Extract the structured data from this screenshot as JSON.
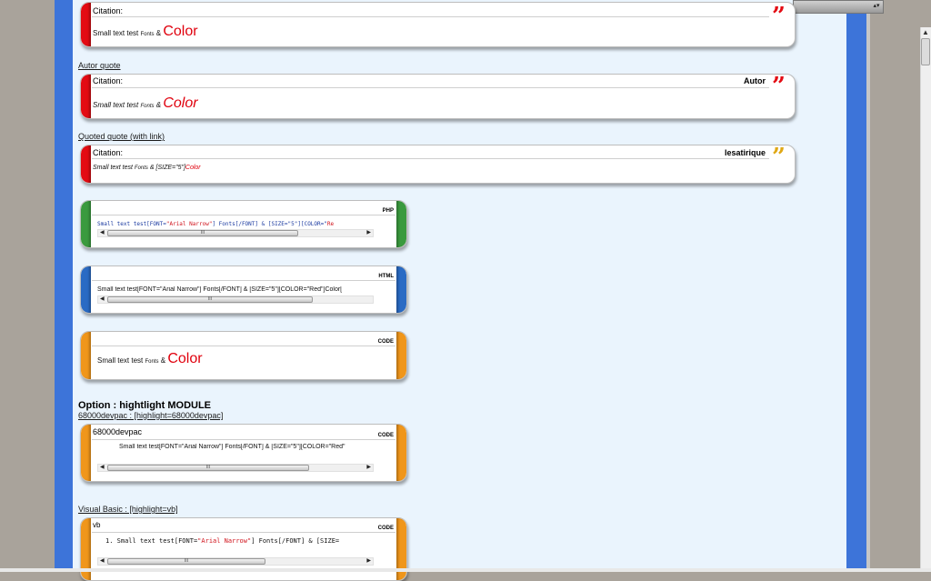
{
  "colors": {
    "quote_bar": "#e30b13",
    "php_bar": "#3a9a3e",
    "html_bar": "#2a6bc4",
    "code_bar": "#f0961b",
    "page_blue": "#3d74d9"
  },
  "quote1": {
    "title": "Citation:",
    "text_a": "Small text test",
    "text_b": "Fonts",
    "text_c": "&",
    "color_word": "Color"
  },
  "autor_link": "Autor quote",
  "quote2": {
    "title": "Citation:",
    "author": "Autor",
    "text_a": "Small text test",
    "text_b": "Fonts",
    "text_c": "&",
    "color_word": "Color"
  },
  "quoted_link": "Quoted quote (with link)",
  "quote3": {
    "title": "Citation:",
    "author": "lesatirique",
    "text_a": "Small text test",
    "text_b": "Fonts",
    "text_c": "& [SIZE=\"5\"]",
    "color_word": "Color"
  },
  "php_box": {
    "tag": "PHP",
    "code_a": "Small text test[FONT=",
    "code_b": "\"Arial Narrow\"",
    "code_c": "] Fonts[/FONT] & [SIZE=\"5\"][COLOR=\"",
    "code_d": "Re"
  },
  "html_box": {
    "tag": "HTML",
    "code": "Small text test[FONT=\"Arial Narrow\"] Fonts[/FONT] & [SIZE=\"5\"][COLOR=\"Red\"]Color["
  },
  "code_box": {
    "tag": "CODE",
    "text_a": "Small text test",
    "text_b": "Fonts",
    "text_c": "&",
    "color_word": "Color"
  },
  "option_heading": "Option : hightlight MODULE",
  "devpac_link": "68000devpac : [highlight=68000devpac]",
  "devpac_box": {
    "tag": "CODE",
    "name": "68000devpac",
    "code": "Small text test[FONT=\"Arial Narrow\"] Fonts[/FONT] & [SIZE=\"5\"][COLOR=\"Red\""
  },
  "vb_link": "Visual Basic : [highlight=vb]",
  "vb_box": {
    "tag": "CODE",
    "name": "vb",
    "line_no": "1.",
    "code_a": "Small text test[FONT=",
    "code_b": "\"Arial Narrow\"",
    "code_c": "] Fonts[/FONT] & [SIZE="
  },
  "scroll_grip": "III",
  "icons": {
    "quote": "quote-marks-icon",
    "scroll_left": "left-arrow-icon",
    "scroll_right": "right-arrow-icon"
  }
}
